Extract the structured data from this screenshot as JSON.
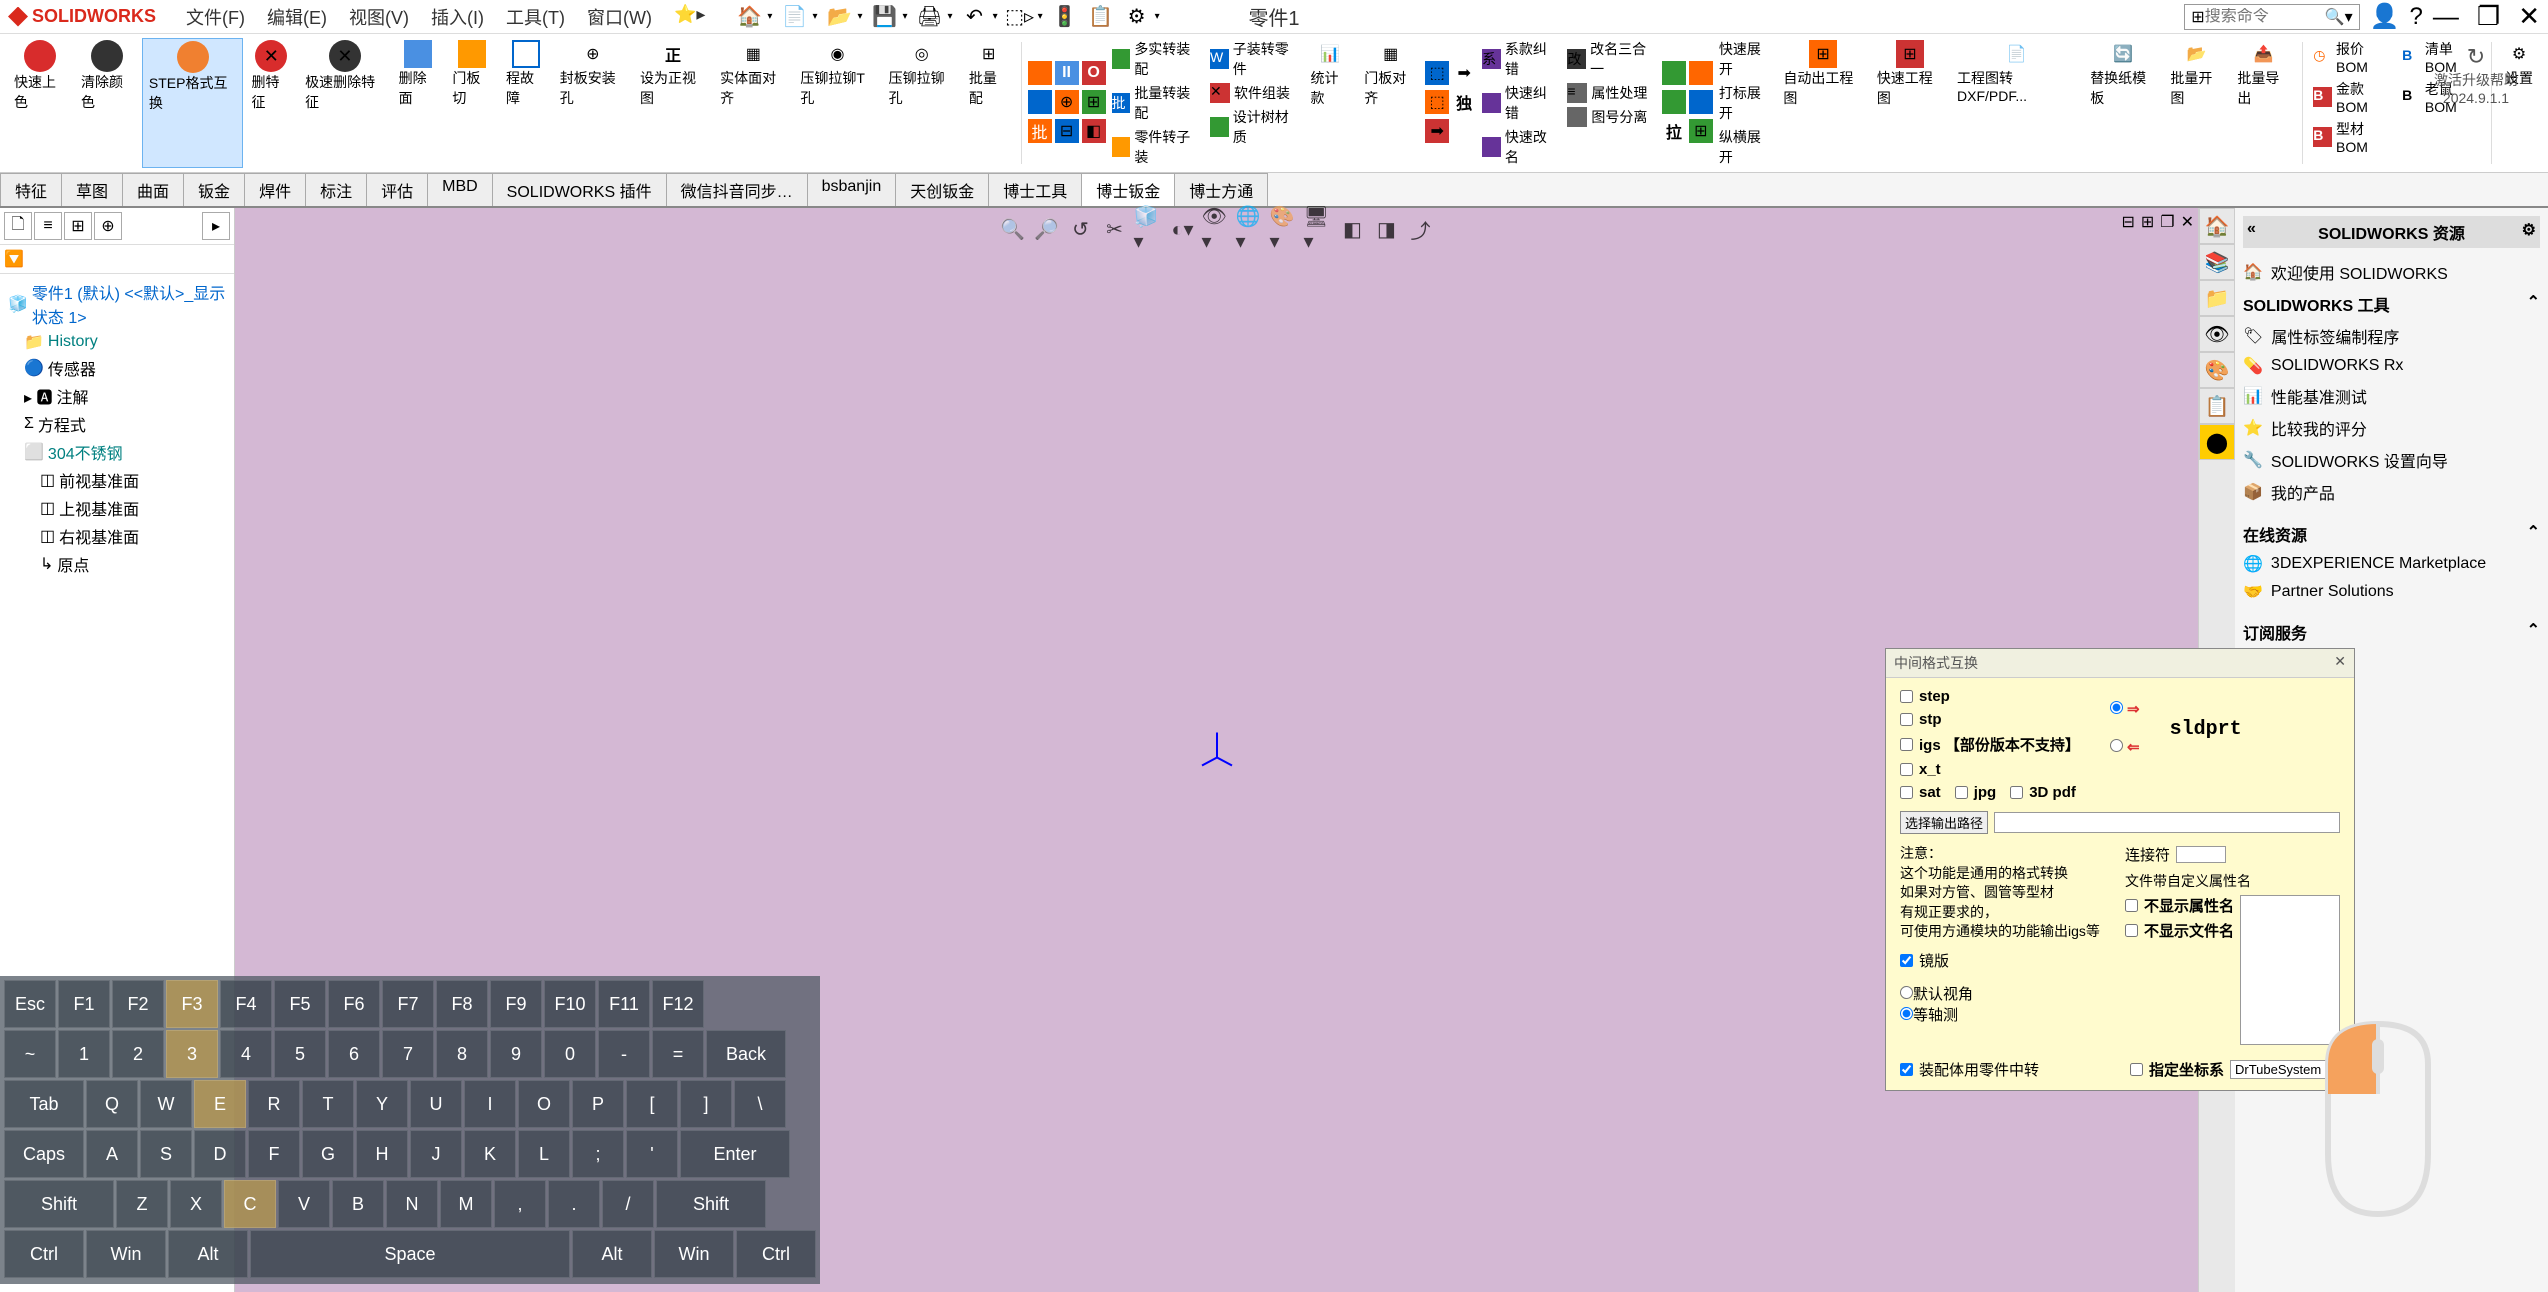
{
  "app": {
    "name": "SOLIDWORKS",
    "doc_title": "零件1"
  },
  "menu": {
    "file": "文件(F)",
    "edit": "编辑(E)",
    "view": "视图(V)",
    "insert": "插入(I)",
    "tools": "工具(T)",
    "window": "窗口(W)"
  },
  "search": {
    "placeholder": "搜索命令"
  },
  "ribbon": {
    "btns": [
      "快速上色",
      "清除颜色",
      "STEP格式互换",
      "删特征",
      "极速删除特征",
      "删除面",
      "门板切",
      "程故障",
      "封板安装孔",
      "设为正视图",
      "实体面对齐",
      "压铆拉铆T孔",
      "压铆拉铆孔",
      "批量配",
      "多实转装配",
      "子装转零件",
      "批量转装配",
      "软件组装",
      "零件转子装",
      "设计树材质",
      "统计款",
      "门板对齐",
      "系款纠错",
      "改名三合一",
      "快速展开",
      "打标展开",
      "纵横展开",
      "自动出工程图",
      "快速工程图",
      "工程图转DXF/PDF...",
      "替换纸模板",
      "批量开图",
      "批量导出",
      "报价BOM",
      "金款BOM",
      "型材BOM",
      "清单BOM",
      "老鼠BOM",
      "设置"
    ],
    "extra": [
      "快速纠错",
      "快速改名",
      "属性处理",
      "图号分离",
      "拉",
      "独"
    ]
  },
  "activate": {
    "line1": "激活升级帮助",
    "line2": "2024.9.1.1"
  },
  "tabs": [
    "特征",
    "草图",
    "曲面",
    "钣金",
    "焊件",
    "标注",
    "评估",
    "MBD",
    "SOLIDWORKS 插件",
    "微信抖音同步…",
    "bsbanjin",
    "天创钣金",
    "博士工具",
    "博士钣金",
    "博士方通"
  ],
  "tree": {
    "root": "零件1 (默认) <<默认>_显示状态 1>",
    "items": [
      "History",
      "传感器",
      "注解",
      "方程式",
      "304不锈钢",
      "前视基准面",
      "上视基准面",
      "右视基准面",
      "原点"
    ]
  },
  "dialog": {
    "title": "中间格式互换",
    "formats": [
      "step",
      "stp",
      "igs 【部份版本不支持】",
      "x_t",
      "sat",
      "jpg",
      "3D pdf"
    ],
    "sldprt": "sldprt",
    "path_label": "选择输出路径",
    "note_title": "注意：",
    "note_lines": [
      "这个功能是通用的格式转换",
      "如果对方管、圆管等型材",
      "有规正要求的，",
      "可使用方通模块的功能输出igs等"
    ],
    "mirror": "镜版",
    "view_default": "默认视角",
    "view_iso": "等轴测",
    "assembly": "装配体用零件中转",
    "conn_label": "连接符",
    "custom_prop": "文件带自定义属性名",
    "no_prop": "不显示属性名",
    "no_file": "不显示文件名",
    "coord_label": "指定坐标系",
    "coord_value": "DrTubeSystem"
  },
  "right_panel": {
    "title": "SOLIDWORKS 资源",
    "welcome": "欢迎使用 SOLIDWORKS",
    "sections": {
      "tools": {
        "title": "SOLIDWORKS 工具",
        "items": [
          "属性标签编制程序",
          "SOLIDWORKS Rx",
          "性能基准测试",
          "比较我的评分",
          "SOLIDWORKS 设置向导",
          "我的产品"
        ]
      },
      "online": {
        "title": "在线资源",
        "items": [
          "3DEXPERIENCE Marketplace",
          "Partner Solutions"
        ]
      },
      "sub": {
        "title": "订阅服务",
        "items": [
          "订阅服务"
        ]
      }
    }
  },
  "keyboard": {
    "r1": [
      "Esc",
      "F1",
      "F2",
      "F3",
      "F4",
      "F5",
      "F6",
      "F7",
      "F8",
      "F9",
      "F10",
      "F11",
      "F12"
    ],
    "r2": [
      "~",
      "1",
      "2",
      "3",
      "4",
      "5",
      "6",
      "7",
      "8",
      "9",
      "0",
      "-",
      "=",
      "Back"
    ],
    "r3": [
      "Tab",
      "Q",
      "W",
      "E",
      "R",
      "T",
      "Y",
      "U",
      "I",
      "O",
      "P",
      "[",
      "]",
      "\\"
    ],
    "r4": [
      "Caps",
      "A",
      "S",
      "D",
      "F",
      "G",
      "H",
      "J",
      "K",
      "L",
      ";",
      "'",
      "Enter"
    ],
    "r5": [
      "Shift",
      "Z",
      "X",
      "C",
      "V",
      "B",
      "N",
      "M",
      ",",
      ".",
      "/",
      "Shift"
    ],
    "r6": [
      "Ctrl",
      "Win",
      "Alt",
      "Space",
      "Alt",
      "Win",
      "Ctrl"
    ]
  }
}
